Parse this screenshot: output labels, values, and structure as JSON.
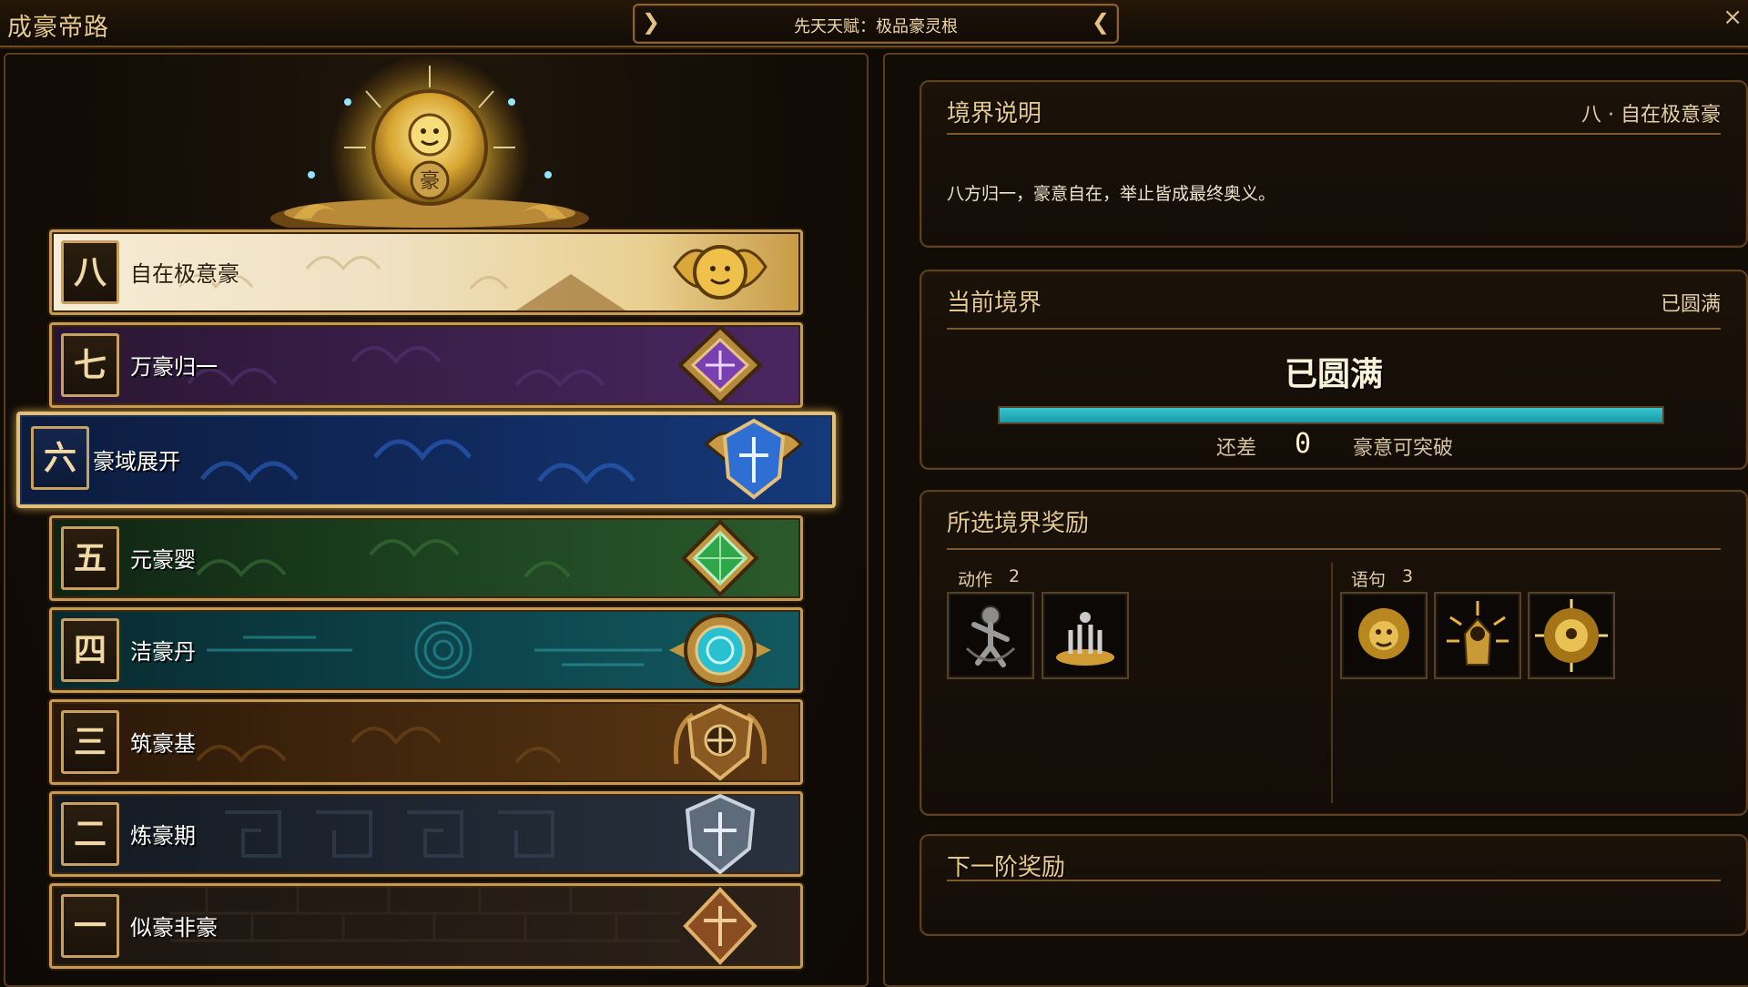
{
  "app": {
    "title": "成豪帝路",
    "talent": "先天天赋：极品豪灵根",
    "close": "×"
  },
  "realms": [
    {
      "num": "八",
      "name": "自在极意豪",
      "theme": "gold"
    },
    {
      "num": "七",
      "name": "万豪归一",
      "theme": "purple"
    },
    {
      "num": "六",
      "name": "豪域展开",
      "theme": "blue",
      "selected": true
    },
    {
      "num": "五",
      "name": "元豪婴",
      "theme": "green"
    },
    {
      "num": "四",
      "name": "洁豪丹",
      "theme": "teal"
    },
    {
      "num": "三",
      "name": "筑豪基",
      "theme": "bronze"
    },
    {
      "num": "二",
      "name": "炼豪期",
      "theme": "slate"
    },
    {
      "num": "一",
      "name": "似豪非豪",
      "theme": "stone"
    }
  ],
  "description": {
    "title": "境界说明",
    "realm": "八 · 自在极意豪",
    "text": "八方归一，豪意自在，举止皆成最终奥义。"
  },
  "current": {
    "title": "当前境界",
    "status_right": "已圆满",
    "status": "已圆满",
    "progress": 1.0,
    "need_prefix": "还差",
    "need_value": "0",
    "need_suffix": "豪意可突破"
  },
  "rewards": {
    "title": "所选境界奖励",
    "actions_label": "动作",
    "actions_count": "2",
    "phrases_label": "语句",
    "phrases_count": "3",
    "action_icons": [
      "dancer-icon",
      "altar-icon"
    ],
    "phrase_icons": [
      "lion-icon",
      "radiant-warrior-icon",
      "sunburst-icon"
    ]
  },
  "next": {
    "title": "下一阶奖励"
  },
  "colors": {
    "accent": "#e7c88d",
    "progress": "#37c5d0",
    "border": "#5c4020"
  }
}
